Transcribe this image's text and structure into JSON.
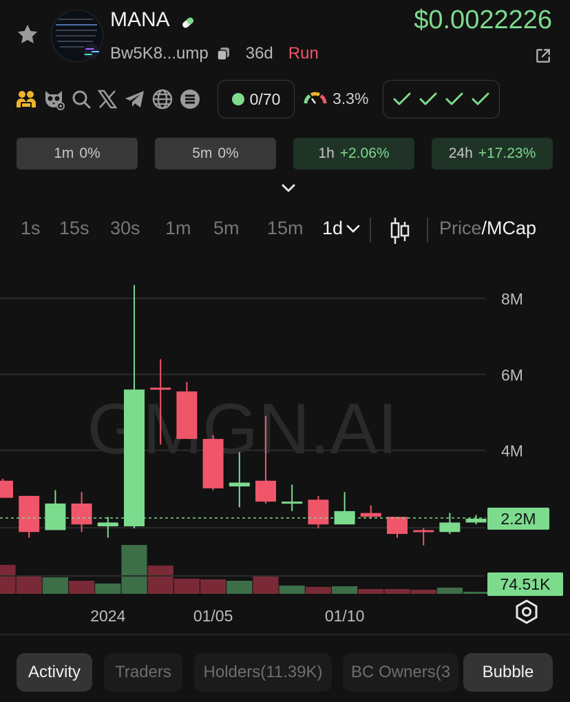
{
  "token": {
    "name": "MANA",
    "address_short": "Bw5K8...ump",
    "age": "36d",
    "status": "Run",
    "price": "$0.0022226"
  },
  "icons": {
    "favorite": "star-icon",
    "chain": "solana-icon",
    "badge": "pill-icon",
    "copy": "copy-icon",
    "external": "external-link-icon",
    "socials": [
      "community-icon",
      "owl-icon",
      "search-icon",
      "x-icon",
      "telegram-icon",
      "globe-icon",
      "solscan-icon"
    ],
    "risk": "gauge-icon",
    "expand": "chevron-down-icon",
    "chart_type": "candlestick-icon",
    "settings": "gear-icon"
  },
  "stats": {
    "holders_ratio": "0/70",
    "gauge_value": "3.3%",
    "check_count": 4
  },
  "changes": [
    {
      "label": "1m",
      "value": "0%",
      "trend": "neutral"
    },
    {
      "label": "5m",
      "value": "0%",
      "trend": "neutral"
    },
    {
      "label": "1h",
      "value": "+2.06%",
      "trend": "up"
    },
    {
      "label": "24h",
      "value": "+17.23%",
      "trend": "up"
    }
  ],
  "intervals": [
    "1s",
    "15s",
    "30s",
    "1m",
    "5m",
    "15m",
    "1d"
  ],
  "active_interval": "1d",
  "price_toggle": {
    "left": "Price",
    "sep": "/",
    "right": "MCap"
  },
  "chart_data": {
    "type": "candlestick",
    "watermark": "GMGN.AI",
    "y_ticks": [
      "8M",
      "6M",
      "4M"
    ],
    "y_tick_values": [
      8000000,
      6000000,
      4000000
    ],
    "ylim": [
      1800000,
      8600000
    ],
    "current_label": "2.2M",
    "current_value": 2220000,
    "volume_label": "74.51K",
    "x_labels": [
      "2024",
      "01/05",
      "01/10"
    ],
    "x_label_index": [
      4,
      8,
      13
    ],
    "candles": [
      {
        "o": 3200000,
        "h": 3250000,
        "l": 2750000,
        "c": 2750000
      },
      {
        "o": 2800000,
        "h": 2800000,
        "l": 1700000,
        "c": 1850000
      },
      {
        "o": 1900000,
        "h": 2950000,
        "l": 1900000,
        "c": 2600000
      },
      {
        "o": 2600000,
        "h": 2900000,
        "l": 1850000,
        "c": 2050000
      },
      {
        "o": 2000000,
        "h": 2250000,
        "l": 1700000,
        "c": 2100000
      },
      {
        "o": 2000000,
        "h": 8350000,
        "l": 1950000,
        "c": 5600000
      },
      {
        "o": 5650000,
        "h": 6400000,
        "l": 4150000,
        "c": 5600000
      },
      {
        "o": 5550000,
        "h": 5800000,
        "l": 4300000,
        "c": 4300000
      },
      {
        "o": 4300000,
        "h": 4400000,
        "l": 2950000,
        "c": 3000000
      },
      {
        "o": 3050000,
        "h": 3950000,
        "l": 2500000,
        "c": 3150000
      },
      {
        "o": 3200000,
        "h": 4900000,
        "l": 2600000,
        "c": 2650000
      },
      {
        "o": 2600000,
        "h": 3100000,
        "l": 2400000,
        "c": 2650000
      },
      {
        "o": 2700000,
        "h": 2800000,
        "l": 1950000,
        "c": 2050000
      },
      {
        "o": 2050000,
        "h": 2900000,
        "l": 2050000,
        "c": 2400000
      },
      {
        "o": 2350000,
        "h": 2550000,
        "l": 2200000,
        "c": 2250000
      },
      {
        "o": 2250000,
        "h": 2250000,
        "l": 1700000,
        "c": 1800000
      },
      {
        "o": 1900000,
        "h": 1950000,
        "l": 1500000,
        "c": 1850000
      },
      {
        "o": 1850000,
        "h": 2350000,
        "l": 1800000,
        "c": 2100000
      },
      {
        "o": 2100000,
        "h": 2300000,
        "l": 2050000,
        "c": 2200000
      }
    ],
    "volumes": [
      0.42,
      0.27,
      0.24,
      0.19,
      0.15,
      0.71,
      0.41,
      0.22,
      0.21,
      0.19,
      0.25,
      0.12,
      0.1,
      0.11,
      0.07,
      0.07,
      0.06,
      0.09,
      0.03
    ],
    "colors": {
      "up": "#7ddb8e",
      "down": "#f0566a",
      "up_vol": "#3d6e48",
      "down_vol": "#7a2a37",
      "grid": "#2c2c2c",
      "label_bg": "#7ddb8e"
    }
  },
  "tabs": [
    {
      "label": "Activity",
      "active": true
    },
    {
      "label": "Traders",
      "active": false
    },
    {
      "label": "Holders(11.39K)",
      "active": false
    },
    {
      "label": "BC Owners(3",
      "active": false
    }
  ],
  "bubble_button": "Bubble"
}
